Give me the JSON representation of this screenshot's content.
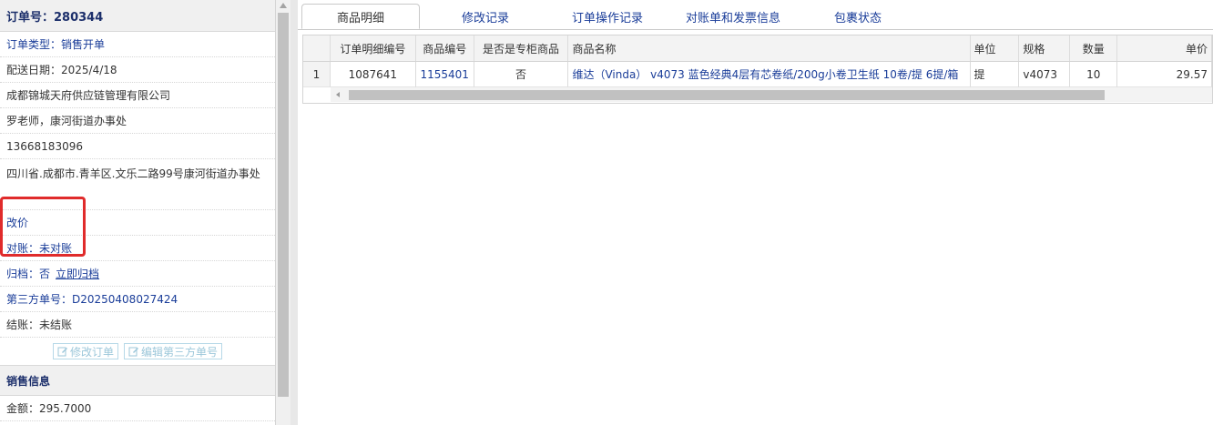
{
  "order": {
    "header": "订单号：280344",
    "type": "订单类型：销售开单",
    "delivery_date": "配送日期：2025/4/18",
    "company": "成都锦城天府供应链管理有限公司",
    "contact": "罗老师，康河街道办事处",
    "phone": "13668183096",
    "address": "四川省.成都市.青羊区.文乐二路99号康河街道办事处",
    "reprice": "改价",
    "reconcile": "对账：未对账",
    "archive_label": "归档：",
    "archive_value": "否",
    "archive_action": "立即归档",
    "third_party": "第三方单号：D20250408027424",
    "settlement": "结账：未结账"
  },
  "buttons": {
    "edit_order": "修改订单",
    "edit_third_party": "编辑第三方单号"
  },
  "sales": {
    "header": "销售信息",
    "amount": "金额：295.7000"
  },
  "tabs": [
    {
      "label": "商品明细",
      "active": true
    },
    {
      "label": "修改记录"
    },
    {
      "label": "订单操作记录"
    },
    {
      "label": "对账单和发票信息"
    },
    {
      "label": "包裹状态"
    }
  ],
  "grid": {
    "columns": [
      "",
      "订单明细编号",
      "商品编号",
      "是否是专柜商品",
      "商品名称",
      "单位",
      "规格",
      "数量",
      "单价"
    ],
    "rows": [
      [
        "1",
        "1087641",
        "1155401",
        "否",
        "维达（Vinda） v4073 蓝色经典4层有芯卷纸/200g小卷卫生纸 10卷/提 6提/箱",
        "提",
        "v4073",
        "10",
        "29.57"
      ]
    ]
  },
  "colors": {
    "link": "#1a3d99",
    "highlight": "#e02b2b"
  }
}
